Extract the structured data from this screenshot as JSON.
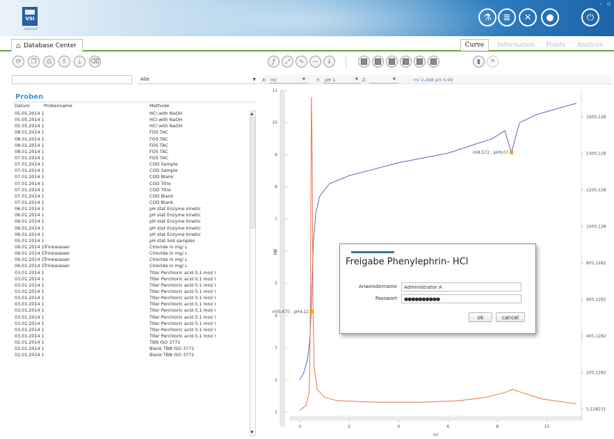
{
  "header": {
    "logo": {
      "text": "VSI",
      "sub": "Laborsoft"
    },
    "icons": [
      "flask-icon",
      "database-icon",
      "tools-icon",
      "user-icon",
      "power-icon"
    ]
  },
  "tabs": {
    "main": "Database Center",
    "right": [
      "Curve",
      "Information",
      "Points",
      "Analysis"
    ]
  },
  "left": {
    "filter_value": "",
    "filter_select": "Alle",
    "section_title": "Proben",
    "columns": [
      "Datum",
      "Probenname",
      "Methode"
    ],
    "rows": [
      [
        "05.05.2014 1",
        "",
        "HCl with NaOH"
      ],
      [
        "05.05.2014 1",
        "",
        "HCl with NaOH"
      ],
      [
        "05.05.2014 1",
        "",
        "HCl with NaOH"
      ],
      [
        "08.01.2014 1",
        "",
        "FOS TAC"
      ],
      [
        "08.01.2014 1",
        "",
        "FOS TAC"
      ],
      [
        "08.01.2014 1",
        "",
        "FOS TAC"
      ],
      [
        "08.01.2014 1",
        "",
        "FOS TAC"
      ],
      [
        "07.01.2014 1",
        "",
        "FOS TAC"
      ],
      [
        "07.01.2014 1",
        "",
        "COD Sample"
      ],
      [
        "07.01.2014 1",
        "",
        "COD Sample"
      ],
      [
        "07.01.2014 1",
        "",
        "COD Blank"
      ],
      [
        "07.01.2014 1",
        "",
        "COD Titre"
      ],
      [
        "07.01.2014 1",
        "",
        "COD Titre"
      ],
      [
        "07.01.2014 1",
        "",
        "COD Blank"
      ],
      [
        "07.01.2014 1",
        "",
        "COD Blank"
      ],
      [
        "06.01.2014 1",
        "",
        "pH stat Enzyme kinetic"
      ],
      [
        "06.01.2014 1",
        "",
        "pH stat Enzyme kinetic"
      ],
      [
        "06.01.2014 1",
        "",
        "pH stat Enzyme kinetic"
      ],
      [
        "06.01.2014 1",
        "",
        "pH stat Enzyme kinetic"
      ],
      [
        "06.01.2014 1",
        "",
        "pH stat Enzyme kinetic"
      ],
      [
        "05.01.2014 1",
        "",
        "pH stat Soil samples"
      ],
      [
        "06.01.2014 1",
        "Trinkwasser",
        "Chloride in mg/ L"
      ],
      [
        "06.01.2014 1",
        "Trinkwasser",
        "Chloride in mg/ L"
      ],
      [
        "06.01.2014 1",
        "Trinkwasser",
        "Chloride in mg/ L"
      ],
      [
        "06.01.2014 1",
        "Trinkwasser",
        "Chloride in mg/ L"
      ],
      [
        "03.01.2014 1",
        "",
        "Titer Perchloric acid 0,1 mol/ l"
      ],
      [
        "03.01.2014 1",
        "",
        "Titer Perchloric acid 0,1 mol/ l"
      ],
      [
        "03.01.2014 1",
        "",
        "Titer Perchloric acid 0,1 mol/ l"
      ],
      [
        "03.01.2014 1",
        "",
        "Titer Perchloric acid 0,1 mol/ l"
      ],
      [
        "03.01.2014 1",
        "",
        "Titer Perchloric acid 0,1 mol/ l"
      ],
      [
        "03.01.2014 1",
        "",
        "Titer Perchloric acid 0,1 mol/ l"
      ],
      [
        "03.01.2014 1",
        "",
        "Titer Perchloric acid 0,1 mol/ l"
      ],
      [
        "03.01.2014 1",
        "",
        "Titer Perchloric acid 0,1 mol/ l"
      ],
      [
        "03.01.2014 1",
        "",
        "Titer Perchloric acid 0,1 mol/ l"
      ],
      [
        "03.01.2014 1",
        "",
        "Titer Perchloric acid 0,1 mol/ l"
      ],
      [
        "03.01.2014 1",
        "",
        "Titer Perchloric acid 0,1 mol/ l"
      ],
      [
        "02.01.2014 1",
        "",
        "TBN ISO 3771"
      ],
      [
        "02.01.2014 1",
        "",
        "Blank TBN ISO 3771"
      ],
      [
        "02.01.2014 1",
        "",
        "Blank TBN ISO 3771"
      ]
    ]
  },
  "axis_bar": {
    "x_label": "X:",
    "x_value": "ml",
    "y_label": "Y:",
    "y_value": "pH 1",
    "z_label": "Z:",
    "z_value": "",
    "readout": "ml 2,468  pH 6,99"
  },
  "chart_data": {
    "type": "line",
    "xlabel": "ml",
    "ylabel": "pH",
    "xlim": [
      -0.4,
      11.4
    ],
    "ylim": [
      1,
      11
    ],
    "x_ticks": [
      0,
      2,
      4,
      6,
      8,
      10
    ],
    "y_ticks": [
      1,
      2,
      3,
      4,
      5,
      6,
      7,
      8,
      9,
      10,
      11
    ],
    "y2_ticks": [
      "1605,128",
      "1405,128",
      "1205,128",
      "1005,128",
      "805,1282",
      "605,1282",
      "405,1282",
      "205,1282",
      "5,128231"
    ],
    "series": [
      {
        "color": "#5b5fc7",
        "points": [
          [
            0,
            2
          ],
          [
            0.15,
            2.2
          ],
          [
            0.3,
            2.6
          ],
          [
            0.4,
            3.2
          ],
          [
            0.45,
            4.0
          ],
          [
            0.5,
            5.2
          ],
          [
            0.55,
            6.3
          ],
          [
            0.65,
            7.2
          ],
          [
            0.8,
            7.7
          ],
          [
            1.2,
            8.1
          ],
          [
            2,
            8.35
          ],
          [
            3,
            8.55
          ],
          [
            4,
            8.75
          ],
          [
            5,
            8.9
          ],
          [
            6,
            9.05
          ],
          [
            7,
            9.3
          ],
          [
            7.8,
            9.5
          ],
          [
            8.3,
            9.75
          ],
          [
            8.57,
            9.07
          ],
          [
            8.9,
            10.0
          ],
          [
            9.6,
            10.25
          ],
          [
            10.5,
            10.45
          ],
          [
            11.2,
            10.6
          ]
        ]
      },
      {
        "color": "#e8704a",
        "points": [
          [
            0,
            1.05
          ],
          [
            0.25,
            1.2
          ],
          [
            0.38,
            1.6
          ],
          [
            0.42,
            3.5
          ],
          [
            0.45,
            8.0
          ],
          [
            0.47,
            10.8
          ],
          [
            0.5,
            9.0
          ],
          [
            0.53,
            4.5
          ],
          [
            0.58,
            2.4
          ],
          [
            0.7,
            1.7
          ],
          [
            1.0,
            1.45
          ],
          [
            1.5,
            1.35
          ],
          [
            3,
            1.3
          ],
          [
            5,
            1.3
          ],
          [
            6.5,
            1.35
          ],
          [
            7.5,
            1.45
          ],
          [
            8.3,
            1.6
          ],
          [
            8.6,
            1.7
          ],
          [
            9,
            1.6
          ],
          [
            9.8,
            1.4
          ],
          [
            11.2,
            1.25
          ]
        ]
      }
    ],
    "annotations": [
      {
        "text": "ml0,475 : pH4,12",
        "x": 0.475,
        "y": 4.12
      },
      {
        "text": "ml8,572 : pH9,07",
        "x": 8.572,
        "y": 9.07
      }
    ]
  },
  "dialog": {
    "title": "Freigabe Phenylephrin- HCl",
    "user_label": "Anwendername",
    "user_value": "Administrator A",
    "pass_label": "Passwort",
    "pass_value": "●●●●●●●●●●",
    "ok": "ok",
    "cancel": "cancel"
  },
  "colors": {
    "accent_green": "#6f9c3f",
    "accent_blue": "#4a8fcc"
  }
}
